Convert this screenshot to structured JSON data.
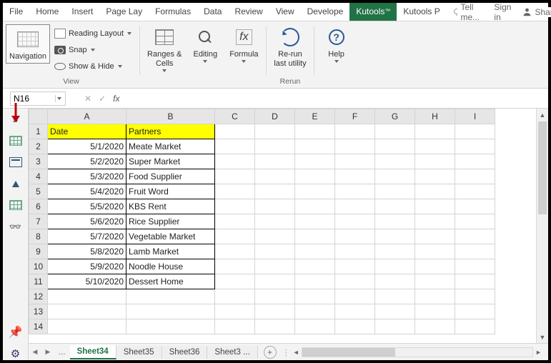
{
  "menu": {
    "file": "File",
    "home": "Home",
    "insert": "Insert",
    "pageLayout": "Page Lay",
    "formulas": "Formulas",
    "data": "Data",
    "review": "Review",
    "view": "View",
    "developer": "Develope",
    "kutools": "Kutools",
    "kutoolsTM": "™",
    "kutoolsPlus": "Kutools P",
    "tellMe": "Tell me...",
    "signIn": "Sign in",
    "share": "Share"
  },
  "ribbon": {
    "navigation": "Navigation",
    "readingLayout": "Reading Layout",
    "snap": "Snap",
    "showHide": "Show & Hide",
    "viewGroup": "View",
    "rangesCells": "Ranges &\nCells",
    "editing": "Editing",
    "formula": "Formula",
    "rerun": "Re-run\nlast utility",
    "rerunGroup": "Rerun",
    "help": "Help"
  },
  "formulaBar": {
    "nameBox": "N16",
    "fx": "fx",
    "cancel": "✕",
    "enter": "✓"
  },
  "grid": {
    "columns": [
      "A",
      "B",
      "C",
      "D",
      "E",
      "F",
      "G",
      "H",
      "I"
    ],
    "h1": "Date",
    "h2": "Partners",
    "rows": [
      {
        "n": "2",
        "a": "5/1/2020",
        "b": "Meate Market"
      },
      {
        "n": "3",
        "a": "5/2/2020",
        "b": "Super Market"
      },
      {
        "n": "4",
        "a": "5/3/2020",
        "b": "Food Supplier"
      },
      {
        "n": "5",
        "a": "5/4/2020",
        "b": "Fruit Word"
      },
      {
        "n": "6",
        "a": "5/5/2020",
        "b": "KBS Rent"
      },
      {
        "n": "7",
        "a": "5/6/2020",
        "b": "Rice Supplier"
      },
      {
        "n": "8",
        "a": "5/7/2020",
        "b": "Vegetable Market"
      },
      {
        "n": "9",
        "a": "5/8/2020",
        "b": "Lamb Market"
      },
      {
        "n": "10",
        "a": "5/9/2020",
        "b": "Noodle House"
      },
      {
        "n": "11",
        "a": "5/10/2020",
        "b": "Dessert Home"
      }
    ],
    "blankRows": [
      "12",
      "13",
      "14"
    ]
  },
  "tabs": {
    "dots": "...",
    "active": "Sheet34",
    "t2": "Sheet35",
    "t3": "Sheet36",
    "t4": "Sheet3",
    "ellipsis": "..."
  }
}
